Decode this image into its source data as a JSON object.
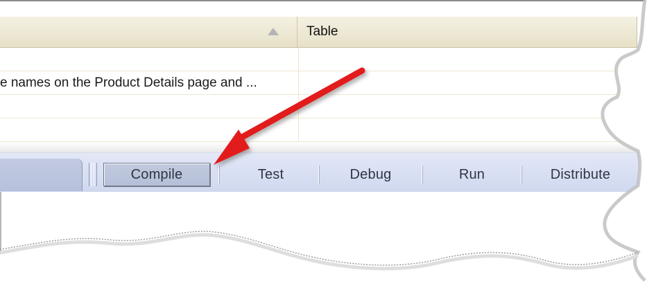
{
  "table": {
    "headers": {
      "description": "",
      "table": "Table"
    },
    "rows": [
      {
        "description": "",
        "table": ""
      },
      {
        "description": "e names on the Product Details page and ...",
        "table": ""
      },
      {
        "description": "",
        "table": ""
      },
      {
        "description": "",
        "table": ""
      }
    ]
  },
  "toolbar": {
    "compile_label": "Compile",
    "test_label": "Test",
    "debug_label": "Debug",
    "run_label": "Run",
    "distribute_label": "Distribute"
  },
  "icons": {
    "sort": "sort-asc-icon",
    "arrow": "red-arrow-icon",
    "grip": "toolbar-grip-icon"
  },
  "colors": {
    "table_header": "#ece7d0",
    "toolbar": "#d7def2",
    "compile_button": "#bcc6dc",
    "arrow": "#e21a1a"
  }
}
